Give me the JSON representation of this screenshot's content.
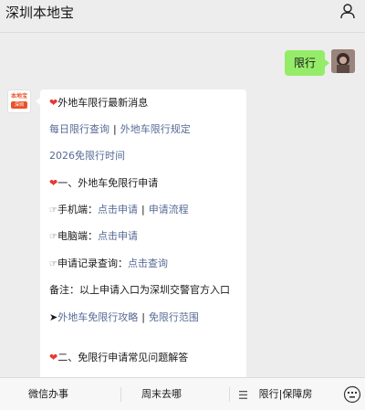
{
  "header": {
    "title": "深圳本地宝",
    "profile_icon": "user-icon"
  },
  "user_message": {
    "text": "限行"
  },
  "bot_avatar": {
    "logo_top": "本地宝",
    "logo_bottom": "深圳"
  },
  "bot_message": {
    "section1_title": "外地车限行最新消息",
    "link_daily": "每日限行查询",
    "separator": "|",
    "link_rules": "外地车限行规定",
    "link_free_time": "2026免限行时间",
    "section2_title": "一、外地车免限行申请",
    "mobile_label": "手机端：",
    "mobile_apply": "点击申请",
    "mobile_flow": "申请流程",
    "pc_label": "电脑端：",
    "pc_apply": "点击申请",
    "record_label": "申请记录查询：",
    "record_query": "点击查询",
    "note": "备注：以上申请入口为深圳交警官方入口",
    "arrow": "➤",
    "link_strategy": "外地车免限行攻略",
    "link_scope": "免限行范围",
    "section3_title": "二、免限行申请常见问题解答",
    "heart_emoji": "❤",
    "hand_emoji": "☞"
  },
  "bottom_menu": {
    "item1": "微信办事",
    "item2": "周末去哪",
    "item3": "限行|保障房",
    "menu_icon": "menu-lines-icon",
    "keyboard_icon": "keyboard-icon"
  },
  "colors": {
    "link": "#576b95",
    "user_bubble": "#95ec69",
    "background": "#ededed",
    "heart": "#e53935"
  }
}
